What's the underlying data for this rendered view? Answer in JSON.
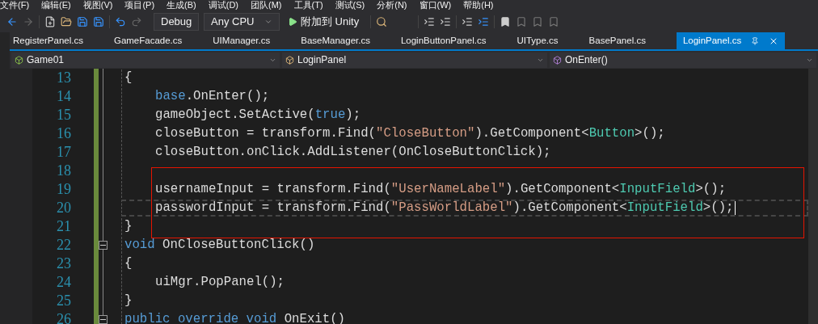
{
  "menu": [
    "文件(F)",
    "编辑(E)",
    "视图(V)",
    "项目(P)",
    "生成(B)",
    "调试(D)",
    "团队(M)",
    "工具(T)",
    "测试(S)",
    "分析(N)",
    "窗口(W)",
    "帮助(H)"
  ],
  "toolbar": {
    "configuration": "Debug",
    "platform": "Any CPU",
    "run": "附加到 Unity"
  },
  "tabs": [
    {
      "label": "RegisterPanel.cs",
      "selected": false
    },
    {
      "label": "GameFacade.cs",
      "selected": false
    },
    {
      "label": "UIManager.cs",
      "selected": false
    },
    {
      "label": "BaseManager.cs",
      "selected": false
    },
    {
      "label": "LoginButtonPanel.cs",
      "selected": false
    },
    {
      "label": "UIType.cs",
      "selected": false
    },
    {
      "label": "BasePanel.cs",
      "selected": false
    },
    {
      "label": "LoginPanel.cs",
      "selected": true
    }
  ],
  "navigation": {
    "project": "Game01",
    "class": "LoginPanel",
    "member": "OnEnter()"
  },
  "annotation": {
    "kind": "rectangle"
  },
  "lines": [
    {
      "number": "13",
      "kind": "member",
      "fold": false,
      "current": false,
      "tokens": [
        {
          "kind": "plain",
          "text": "{"
        }
      ]
    },
    {
      "number": "14",
      "kind": "statement",
      "fold": false,
      "current": false,
      "tokens": [
        {
          "kind": "keyword",
          "text": "base"
        },
        {
          "kind": "plain",
          "text": ".OnEnter();"
        }
      ]
    },
    {
      "number": "15",
      "kind": "statement",
      "fold": false,
      "current": false,
      "tokens": [
        {
          "kind": "plain",
          "text": "gameObject.SetActive("
        },
        {
          "kind": "keyword",
          "text": "true"
        },
        {
          "kind": "plain",
          "text": ");"
        }
      ]
    },
    {
      "number": "16",
      "kind": "statement",
      "fold": false,
      "current": false,
      "tokens": [
        {
          "kind": "plain",
          "text": "closeButton = transform.Find("
        },
        {
          "kind": "string",
          "text": "\"CloseButton\""
        },
        {
          "kind": "plain",
          "text": ").GetComponent<"
        },
        {
          "kind": "type",
          "text": "Button"
        },
        {
          "kind": "plain",
          "text": ">();"
        }
      ]
    },
    {
      "number": "17",
      "kind": "statement",
      "fold": false,
      "current": false,
      "tokens": [
        {
          "kind": "plain",
          "text": "closeButton.onClick.AddListener(OnCloseButtonClick);"
        }
      ]
    },
    {
      "number": "18",
      "kind": "statement",
      "fold": false,
      "current": false
    },
    {
      "number": "19",
      "kind": "statement",
      "fold": false,
      "current": false,
      "tokens": [
        {
          "kind": "plain",
          "text": "usernameInput = transform.Find("
        },
        {
          "kind": "string",
          "text": "\"UserNameLabel\""
        },
        {
          "kind": "plain",
          "text": ").GetComponent<"
        },
        {
          "kind": "type",
          "text": "InputField"
        },
        {
          "kind": "plain",
          "text": ">();"
        }
      ]
    },
    {
      "number": "20",
      "kind": "statement",
      "fold": false,
      "current": true,
      "tokens": [
        {
          "kind": "plain",
          "text": "passwordInput = transform.Find("
        },
        {
          "kind": "string",
          "text": "\"PassWorldLabel\""
        },
        {
          "kind": "plain",
          "text": ").GetComponent<"
        },
        {
          "kind": "type",
          "text": "InputField"
        },
        {
          "kind": "plain",
          "text": ">();"
        }
      ]
    },
    {
      "number": "21",
      "kind": "member",
      "fold": false,
      "current": false,
      "tokens": [
        {
          "kind": "plain",
          "text": "}"
        }
      ]
    },
    {
      "number": "22",
      "kind": "member",
      "fold": true,
      "current": false,
      "tokens": [
        {
          "kind": "keyword",
          "text": "void"
        },
        {
          "kind": "plain",
          "text": " OnCloseButtonClick()"
        }
      ]
    },
    {
      "number": "23",
      "kind": "member",
      "fold": false,
      "current": false,
      "tokens": [
        {
          "kind": "plain",
          "text": "{"
        }
      ]
    },
    {
      "number": "24",
      "kind": "statement",
      "fold": false,
      "current": false,
      "tokens": [
        {
          "kind": "plain",
          "text": "uiMgr.PopPanel();"
        }
      ]
    },
    {
      "number": "25",
      "kind": "member",
      "fold": false,
      "current": false,
      "tokens": [
        {
          "kind": "plain",
          "text": "}"
        }
      ]
    },
    {
      "number": "26",
      "kind": "member",
      "fold": true,
      "current": false,
      "tokens": [
        {
          "kind": "keyword",
          "text": "public override void"
        },
        {
          "kind": "plain",
          "text": " OnExit()"
        }
      ]
    }
  ]
}
